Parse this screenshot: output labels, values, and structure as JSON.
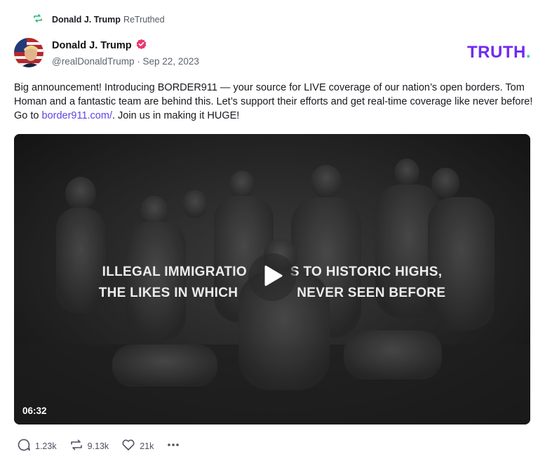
{
  "retruth": {
    "icon": "retruth-icon",
    "name": "Donald J. Trump",
    "suffix": "ReTruthed"
  },
  "post": {
    "author_name": "Donald J. Trump",
    "verified_icon": "verified-badge-icon",
    "handle": "@realDonaldTrump",
    "separator": "·",
    "date": "Sep 22, 2023",
    "text_before_link": "Big announcement! Introducing BORDER911 — your source for LIVE coverage of our nation’s open borders. Tom Homan and a fantastic team are behind this. Let’s support their efforts and get real-time coverage like never before! Go to ",
    "link_text": "border911.com/",
    "text_after_link": ". Join us in making it HUGE!"
  },
  "brand": {
    "logo_text": "TRUTH",
    "logo_dot": ".",
    "logo_color": "#6f2cf2",
    "dot_color": "#38d3a6"
  },
  "video": {
    "caption_line1": "ILLEGAL IMMIGRATIO",
    "caption_line1_end": "S TO HISTORIC HIGHS,",
    "caption_line2": "THE LIKES IN WHICH",
    "caption_line2_end": "NEVER SEEN BEFORE",
    "duration": "06:32",
    "play_icon": "play-icon"
  },
  "actions": {
    "replies": "1.23k",
    "retruths": "9.13k",
    "likes": "21k",
    "reply_icon": "reply-icon",
    "retruth_icon": "retruth-icon",
    "like_icon": "heart-icon",
    "more_icon": "more-icon"
  }
}
